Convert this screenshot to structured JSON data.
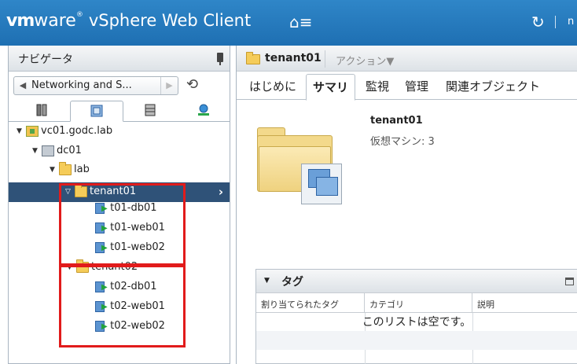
{
  "header": {
    "brand_vm": "vm",
    "brand_ware": "ware",
    "brand_tm": "®",
    "brand_product": "vSphere Web Client",
    "home_icon": "⌂≡",
    "refresh_icon": "↻",
    "user_text": "n"
  },
  "navigator": {
    "title": "ナビゲータ",
    "back_label": "Networking and S...",
    "tabs": [
      "hosts-clusters-icon",
      "vms-templates-icon",
      "storage-icon",
      "networking-icon"
    ],
    "tree": [
      {
        "label": "vc01.godc.lab",
        "type": "vcenter",
        "level": 0
      },
      {
        "label": "dc01",
        "type": "datacenter",
        "level": 1
      },
      {
        "label": "lab",
        "type": "folder",
        "level": 2
      },
      {
        "label": "tenant01",
        "type": "folder",
        "level": 3,
        "selected": true
      },
      {
        "label": "t01-db01",
        "type": "vm",
        "level": 4
      },
      {
        "label": "t01-web01",
        "type": "vm",
        "level": 4
      },
      {
        "label": "t01-web02",
        "type": "vm",
        "level": 4
      },
      {
        "label": "tenant02",
        "type": "folder",
        "level": 3
      },
      {
        "label": "t02-db01",
        "type": "vm",
        "level": 4
      },
      {
        "label": "t02-web01",
        "type": "vm",
        "level": 4
      },
      {
        "label": "t02-web02",
        "type": "vm",
        "level": 4
      }
    ]
  },
  "main": {
    "title": "tenant01",
    "actions_label": "アクション▼",
    "tabs": [
      "はじめに",
      "サマリ",
      "監視",
      "管理",
      "関連オブジェクト"
    ],
    "active_tab": "サマリ",
    "summary": {
      "name": "tenant01",
      "vm_count_label": "仮想マシン:",
      "vm_count": "3"
    },
    "tags": {
      "title": "タグ",
      "columns": [
        "割り当てられたタグ",
        "カテゴリ",
        "説明"
      ],
      "empty_text": "このリストは空です。"
    }
  },
  "colors": {
    "header_blue": "#2478bd",
    "selection": "#2f5278",
    "highlight_box": "#e11b1b"
  }
}
